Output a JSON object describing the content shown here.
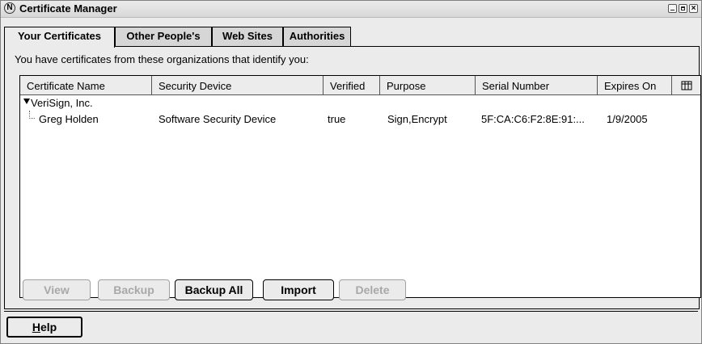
{
  "window": {
    "title": "Certificate Manager",
    "app_icon": "netscape-logo-icon"
  },
  "tabs": [
    {
      "label": "Your Certificates",
      "active": true
    },
    {
      "label": "Other People's",
      "active": false
    },
    {
      "label": "Web Sites",
      "active": false
    },
    {
      "label": "Authorities",
      "active": false
    }
  ],
  "intro_text": "You have certificates from these organizations that identify you:",
  "table": {
    "columns": [
      "Certificate Name",
      "Security Device",
      "Verified",
      "Purpose",
      "Serial Number",
      "Expires On"
    ],
    "column_picker_icon": "column-picker-icon",
    "group": {
      "name": "VeriSign, Inc.",
      "expanded": true
    },
    "rows": [
      {
        "name": "Greg Holden",
        "device": "Software Security Device",
        "verified": "true",
        "purpose": "Sign,Encrypt",
        "serial": "5F:CA:C6:F2:8E:91:...",
        "expires": "1/9/2005"
      }
    ]
  },
  "buttons": {
    "view": "View",
    "backup": "Backup",
    "backup_all": "Backup All",
    "import": "Import",
    "delete": "Delete"
  },
  "help_button": {
    "prefix": "H",
    "rest": "elp"
  }
}
